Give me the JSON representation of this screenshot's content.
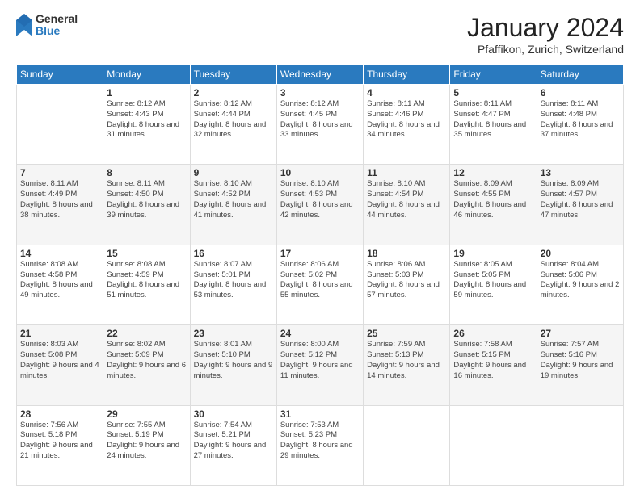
{
  "header": {
    "logo_general": "General",
    "logo_blue": "Blue",
    "month_title": "January 2024",
    "location": "Pfaffikon, Zurich, Switzerland"
  },
  "weekdays": [
    "Sunday",
    "Monday",
    "Tuesday",
    "Wednesday",
    "Thursday",
    "Friday",
    "Saturday"
  ],
  "weeks": [
    [
      {
        "day": "",
        "sunrise": "",
        "sunset": "",
        "daylight": ""
      },
      {
        "day": "1",
        "sunrise": "Sunrise: 8:12 AM",
        "sunset": "Sunset: 4:43 PM",
        "daylight": "Daylight: 8 hours and 31 minutes."
      },
      {
        "day": "2",
        "sunrise": "Sunrise: 8:12 AM",
        "sunset": "Sunset: 4:44 PM",
        "daylight": "Daylight: 8 hours and 32 minutes."
      },
      {
        "day": "3",
        "sunrise": "Sunrise: 8:12 AM",
        "sunset": "Sunset: 4:45 PM",
        "daylight": "Daylight: 8 hours and 33 minutes."
      },
      {
        "day": "4",
        "sunrise": "Sunrise: 8:11 AM",
        "sunset": "Sunset: 4:46 PM",
        "daylight": "Daylight: 8 hours and 34 minutes."
      },
      {
        "day": "5",
        "sunrise": "Sunrise: 8:11 AM",
        "sunset": "Sunset: 4:47 PM",
        "daylight": "Daylight: 8 hours and 35 minutes."
      },
      {
        "day": "6",
        "sunrise": "Sunrise: 8:11 AM",
        "sunset": "Sunset: 4:48 PM",
        "daylight": "Daylight: 8 hours and 37 minutes."
      }
    ],
    [
      {
        "day": "7",
        "sunrise": "Sunrise: 8:11 AM",
        "sunset": "Sunset: 4:49 PM",
        "daylight": "Daylight: 8 hours and 38 minutes."
      },
      {
        "day": "8",
        "sunrise": "Sunrise: 8:11 AM",
        "sunset": "Sunset: 4:50 PM",
        "daylight": "Daylight: 8 hours and 39 minutes."
      },
      {
        "day": "9",
        "sunrise": "Sunrise: 8:10 AM",
        "sunset": "Sunset: 4:52 PM",
        "daylight": "Daylight: 8 hours and 41 minutes."
      },
      {
        "day": "10",
        "sunrise": "Sunrise: 8:10 AM",
        "sunset": "Sunset: 4:53 PM",
        "daylight": "Daylight: 8 hours and 42 minutes."
      },
      {
        "day": "11",
        "sunrise": "Sunrise: 8:10 AM",
        "sunset": "Sunset: 4:54 PM",
        "daylight": "Daylight: 8 hours and 44 minutes."
      },
      {
        "day": "12",
        "sunrise": "Sunrise: 8:09 AM",
        "sunset": "Sunset: 4:55 PM",
        "daylight": "Daylight: 8 hours and 46 minutes."
      },
      {
        "day": "13",
        "sunrise": "Sunrise: 8:09 AM",
        "sunset": "Sunset: 4:57 PM",
        "daylight": "Daylight: 8 hours and 47 minutes."
      }
    ],
    [
      {
        "day": "14",
        "sunrise": "Sunrise: 8:08 AM",
        "sunset": "Sunset: 4:58 PM",
        "daylight": "Daylight: 8 hours and 49 minutes."
      },
      {
        "day": "15",
        "sunrise": "Sunrise: 8:08 AM",
        "sunset": "Sunset: 4:59 PM",
        "daylight": "Daylight: 8 hours and 51 minutes."
      },
      {
        "day": "16",
        "sunrise": "Sunrise: 8:07 AM",
        "sunset": "Sunset: 5:01 PM",
        "daylight": "Daylight: 8 hours and 53 minutes."
      },
      {
        "day": "17",
        "sunrise": "Sunrise: 8:06 AM",
        "sunset": "Sunset: 5:02 PM",
        "daylight": "Daylight: 8 hours and 55 minutes."
      },
      {
        "day": "18",
        "sunrise": "Sunrise: 8:06 AM",
        "sunset": "Sunset: 5:03 PM",
        "daylight": "Daylight: 8 hours and 57 minutes."
      },
      {
        "day": "19",
        "sunrise": "Sunrise: 8:05 AM",
        "sunset": "Sunset: 5:05 PM",
        "daylight": "Daylight: 8 hours and 59 minutes."
      },
      {
        "day": "20",
        "sunrise": "Sunrise: 8:04 AM",
        "sunset": "Sunset: 5:06 PM",
        "daylight": "Daylight: 9 hours and 2 minutes."
      }
    ],
    [
      {
        "day": "21",
        "sunrise": "Sunrise: 8:03 AM",
        "sunset": "Sunset: 5:08 PM",
        "daylight": "Daylight: 9 hours and 4 minutes."
      },
      {
        "day": "22",
        "sunrise": "Sunrise: 8:02 AM",
        "sunset": "Sunset: 5:09 PM",
        "daylight": "Daylight: 9 hours and 6 minutes."
      },
      {
        "day": "23",
        "sunrise": "Sunrise: 8:01 AM",
        "sunset": "Sunset: 5:10 PM",
        "daylight": "Daylight: 9 hours and 9 minutes."
      },
      {
        "day": "24",
        "sunrise": "Sunrise: 8:00 AM",
        "sunset": "Sunset: 5:12 PM",
        "daylight": "Daylight: 9 hours and 11 minutes."
      },
      {
        "day": "25",
        "sunrise": "Sunrise: 7:59 AM",
        "sunset": "Sunset: 5:13 PM",
        "daylight": "Daylight: 9 hours and 14 minutes."
      },
      {
        "day": "26",
        "sunrise": "Sunrise: 7:58 AM",
        "sunset": "Sunset: 5:15 PM",
        "daylight": "Daylight: 9 hours and 16 minutes."
      },
      {
        "day": "27",
        "sunrise": "Sunrise: 7:57 AM",
        "sunset": "Sunset: 5:16 PM",
        "daylight": "Daylight: 9 hours and 19 minutes."
      }
    ],
    [
      {
        "day": "28",
        "sunrise": "Sunrise: 7:56 AM",
        "sunset": "Sunset: 5:18 PM",
        "daylight": "Daylight: 9 hours and 21 minutes."
      },
      {
        "day": "29",
        "sunrise": "Sunrise: 7:55 AM",
        "sunset": "Sunset: 5:19 PM",
        "daylight": "Daylight: 9 hours and 24 minutes."
      },
      {
        "day": "30",
        "sunrise": "Sunrise: 7:54 AM",
        "sunset": "Sunset: 5:21 PM",
        "daylight": "Daylight: 9 hours and 27 minutes."
      },
      {
        "day": "31",
        "sunrise": "Sunrise: 7:53 AM",
        "sunset": "Sunset: 5:23 PM",
        "daylight": "Daylight: 8 hours and 29 minutes."
      },
      {
        "day": "",
        "sunrise": "",
        "sunset": "",
        "daylight": ""
      },
      {
        "day": "",
        "sunrise": "",
        "sunset": "",
        "daylight": ""
      },
      {
        "day": "",
        "sunrise": "",
        "sunset": "",
        "daylight": ""
      }
    ]
  ]
}
